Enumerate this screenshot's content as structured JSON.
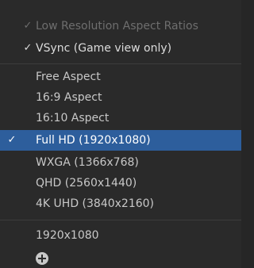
{
  "top_options": [
    {
      "label": "Low Resolution Aspect Ratios",
      "checked": true,
      "enabled": false
    },
    {
      "label": "VSync (Game view only)",
      "checked": true,
      "enabled": true
    }
  ],
  "aspect_items": [
    {
      "label": "Free Aspect",
      "selected": false
    },
    {
      "label": "16:9 Aspect",
      "selected": false
    },
    {
      "label": "16:10 Aspect",
      "selected": false
    },
    {
      "label": "Full HD (1920x1080)",
      "selected": true
    },
    {
      "label": "WXGA (1366x768)",
      "selected": false
    },
    {
      "label": "QHD (2560x1440)",
      "selected": false
    },
    {
      "label": "4K UHD (3840x2160)",
      "selected": false
    }
  ],
  "custom_items": [
    {
      "label": "1920x1080"
    }
  ],
  "check_glyph": "✓",
  "add_icon": "plus-circle-icon",
  "colors": {
    "background": "#2a2a2a",
    "selection": "#2d5e9c",
    "text": "#dcdcdc",
    "disabled_text": "#6e6e6e"
  }
}
